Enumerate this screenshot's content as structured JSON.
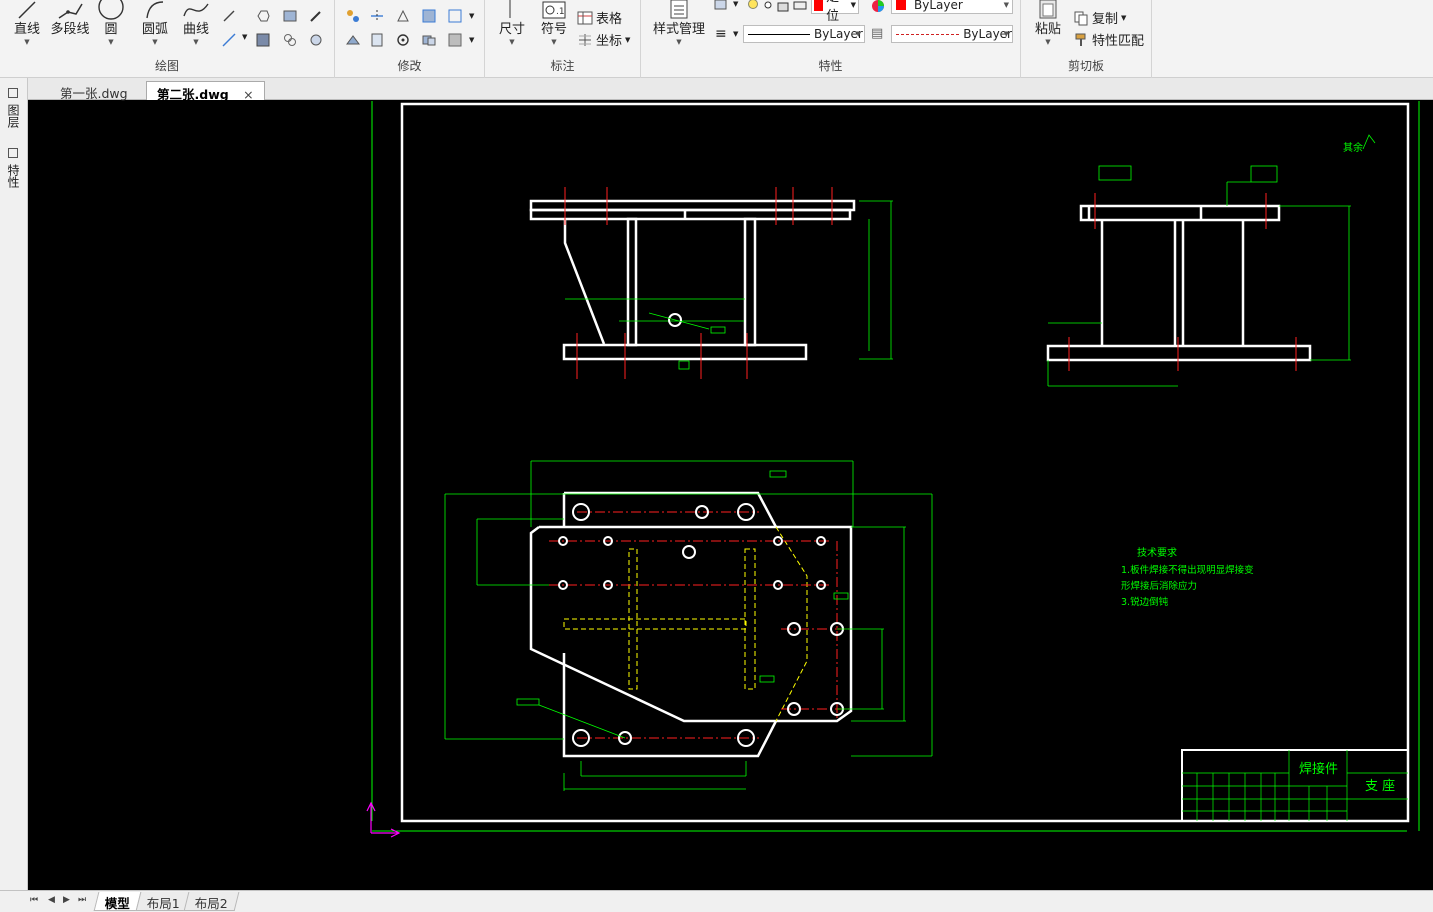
{
  "ribbon": {
    "draw_panel": {
      "title": "绘图",
      "line": "直线",
      "polyline": "多段线",
      "circle": "圆",
      "arc": "圆弧",
      "curve": "曲线"
    },
    "modify_panel": {
      "title": "修改"
    },
    "annotate_panel": {
      "title": "标注",
      "dimension": "尺寸",
      "symbol": "符号",
      "table": "表格",
      "coordinate": "坐标"
    },
    "properties_panel": {
      "title": "特性",
      "style_manager": "样式管理",
      "layer_state": "定位",
      "color_value": "ByLayer",
      "linetype_value": "ByLayer",
      "lineweight_value": "ByLayer"
    },
    "clipboard_panel": {
      "title": "剪切板",
      "paste": "粘贴",
      "copy": "复制",
      "match_properties": "特性匹配"
    }
  },
  "doc_tabs": [
    {
      "label": "第一张.dwg",
      "active": false
    },
    {
      "label": "第二张.dwg",
      "active": true
    }
  ],
  "left_palette": {
    "layers_label": "图层",
    "properties_label": "特性"
  },
  "drawing": {
    "tech_requirements_title": "技术要求",
    "tech_requirements_lines": [
      "1.板件焊接不得出现明显焊接变",
      "形焊接后消除应力",
      "3.锐边倒钝"
    ],
    "title_block_part": "焊接件",
    "title_block_name": "支 座",
    "corner_note": "其余"
  },
  "layout_tabs": [
    "模型",
    "布局1",
    "布局2"
  ],
  "colors": {
    "outline": "#ffffff",
    "dimension": "#00ff00",
    "centerline": "#ff2020",
    "hidden": "#ffff00",
    "ucs": "#ff00ff"
  }
}
